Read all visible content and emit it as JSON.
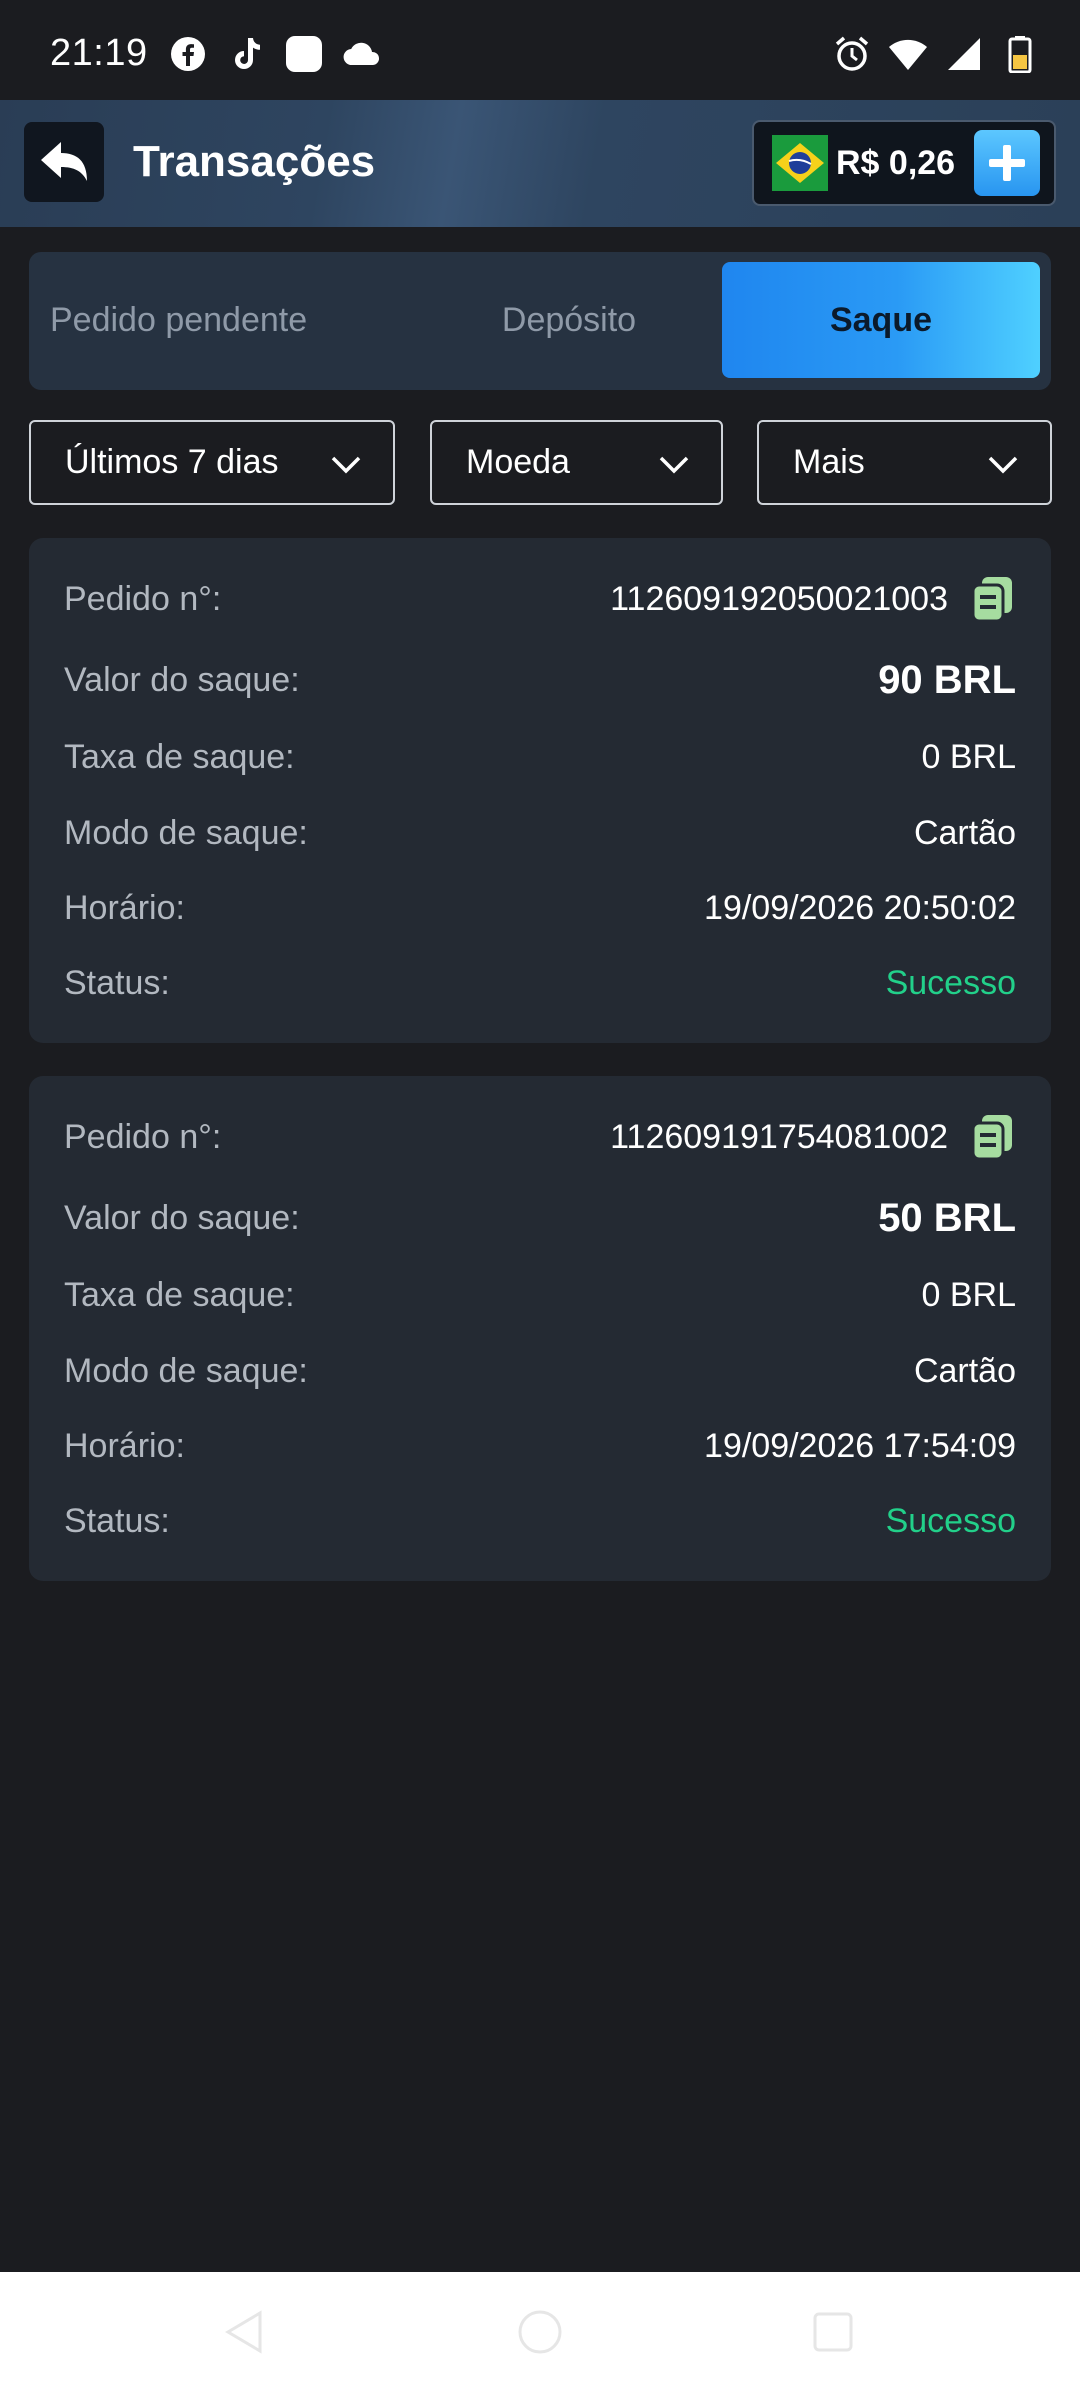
{
  "status_bar": {
    "time": "21:19",
    "left_icons": [
      "facebook-icon",
      "tiktok-icon",
      "app-icon",
      "cloud-icon"
    ],
    "right_icons": [
      "alarm-icon",
      "wifi-icon",
      "signal-icon",
      "battery-icon"
    ]
  },
  "header": {
    "title": "Transações",
    "balance": "R$ 0,26",
    "flag": "brazil-flag-icon"
  },
  "tabs": [
    {
      "label": "Pedido pendente",
      "active": false
    },
    {
      "label": "Depósito",
      "active": false
    },
    {
      "label": "Saque",
      "active": true
    }
  ],
  "filters": {
    "period": "Últimos 7 dias",
    "currency": "Moeda",
    "more": "Mais"
  },
  "labels": {
    "order_no": "Pedido n°:",
    "amount": "Valor do saque:",
    "fee": "Taxa de saque:",
    "mode": "Modo de saque:",
    "time": "Horário:",
    "status": "Status:"
  },
  "transactions": [
    {
      "order_no": "112609192050021003",
      "amount": "90 BRL",
      "fee": "0 BRL",
      "mode": "Cartão",
      "time": "19/09/2026 20:50:02",
      "status": "Sucesso"
    },
    {
      "order_no": "112609191754081002",
      "amount": "50 BRL",
      "fee": "0 BRL",
      "mode": "Cartão",
      "time": "19/09/2026 17:54:09",
      "status": "Sucesso"
    }
  ],
  "colors": {
    "background": "#1b1c20",
    "card": "#242a33",
    "accent": "#2a9af5",
    "success": "#22d08a",
    "copy_icon": "#a6dca0"
  }
}
